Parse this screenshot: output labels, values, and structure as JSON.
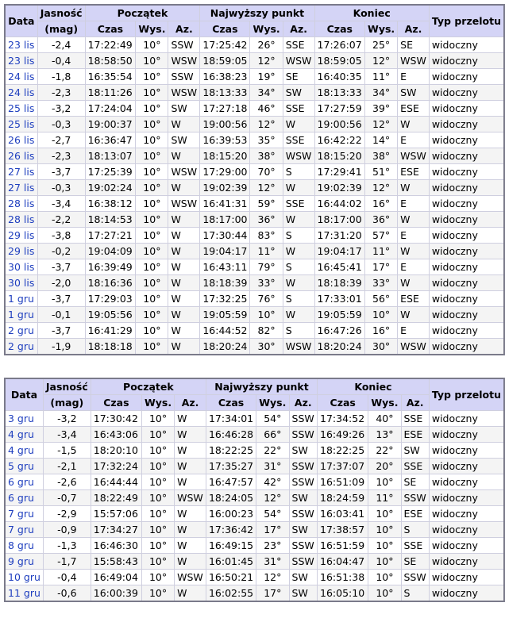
{
  "headers": {
    "data": "Data",
    "jasnosc": "Jasność",
    "mag": "(mag)",
    "poczatek": "Początek",
    "najwyzszy": "Najwyższy punkt",
    "koniec": "Koniec",
    "typ": "Typ przelotu",
    "czas": "Czas",
    "wys": "Wys.",
    "az": "Az."
  },
  "tables": [
    {
      "rows": [
        [
          "23 lis",
          "-2,4",
          "17:22:49",
          "10°",
          "SSW",
          "17:25:42",
          "26°",
          "SSE",
          "17:26:07",
          "25°",
          "SE",
          "widoczny"
        ],
        [
          "23 lis",
          "-0,4",
          "18:58:50",
          "10°",
          "WSW",
          "18:59:05",
          "12°",
          "WSW",
          "18:59:05",
          "12°",
          "WSW",
          "widoczny"
        ],
        [
          "24 lis",
          "-1,8",
          "16:35:54",
          "10°",
          "SSW",
          "16:38:23",
          "19°",
          "SE",
          "16:40:35",
          "11°",
          "E",
          "widoczny"
        ],
        [
          "24 lis",
          "-2,3",
          "18:11:26",
          "10°",
          "WSW",
          "18:13:33",
          "34°",
          "SW",
          "18:13:33",
          "34°",
          "SW",
          "widoczny"
        ],
        [
          "25 lis",
          "-3,2",
          "17:24:04",
          "10°",
          "SW",
          "17:27:18",
          "46°",
          "SSE",
          "17:27:59",
          "39°",
          "ESE",
          "widoczny"
        ],
        [
          "25 lis",
          "-0,3",
          "19:00:37",
          "10°",
          "W",
          "19:00:56",
          "12°",
          "W",
          "19:00:56",
          "12°",
          "W",
          "widoczny"
        ],
        [
          "26 lis",
          "-2,7",
          "16:36:47",
          "10°",
          "SW",
          "16:39:53",
          "35°",
          "SSE",
          "16:42:22",
          "14°",
          "E",
          "widoczny"
        ],
        [
          "26 lis",
          "-2,3",
          "18:13:07",
          "10°",
          "W",
          "18:15:20",
          "38°",
          "WSW",
          "18:15:20",
          "38°",
          "WSW",
          "widoczny"
        ],
        [
          "27 lis",
          "-3,7",
          "17:25:39",
          "10°",
          "WSW",
          "17:29:00",
          "70°",
          "S",
          "17:29:41",
          "51°",
          "ESE",
          "widoczny"
        ],
        [
          "27 lis",
          "-0,3",
          "19:02:24",
          "10°",
          "W",
          "19:02:39",
          "12°",
          "W",
          "19:02:39",
          "12°",
          "W",
          "widoczny"
        ],
        [
          "28 lis",
          "-3,4",
          "16:38:12",
          "10°",
          "WSW",
          "16:41:31",
          "59°",
          "SSE",
          "16:44:02",
          "16°",
          "E",
          "widoczny"
        ],
        [
          "28 lis",
          "-2,2",
          "18:14:53",
          "10°",
          "W",
          "18:17:00",
          "36°",
          "W",
          "18:17:00",
          "36°",
          "W",
          "widoczny"
        ],
        [
          "29 lis",
          "-3,8",
          "17:27:21",
          "10°",
          "W",
          "17:30:44",
          "83°",
          "S",
          "17:31:20",
          "57°",
          "E",
          "widoczny"
        ],
        [
          "29 lis",
          "-0,2",
          "19:04:09",
          "10°",
          "W",
          "19:04:17",
          "11°",
          "W",
          "19:04:17",
          "11°",
          "W",
          "widoczny"
        ],
        [
          "30 lis",
          "-3,7",
          "16:39:49",
          "10°",
          "W",
          "16:43:11",
          "79°",
          "S",
          "16:45:41",
          "17°",
          "E",
          "widoczny"
        ],
        [
          "30 lis",
          "-2,0",
          "18:16:36",
          "10°",
          "W",
          "18:18:39",
          "33°",
          "W",
          "18:18:39",
          "33°",
          "W",
          "widoczny"
        ],
        [
          "1 gru",
          "-3,7",
          "17:29:03",
          "10°",
          "W",
          "17:32:25",
          "76°",
          "S",
          "17:33:01",
          "56°",
          "ESE",
          "widoczny"
        ],
        [
          "1 gru",
          "-0,1",
          "19:05:56",
          "10°",
          "W",
          "19:05:59",
          "10°",
          "W",
          "19:05:59",
          "10°",
          "W",
          "widoczny"
        ],
        [
          "2 gru",
          "-3,7",
          "16:41:29",
          "10°",
          "W",
          "16:44:52",
          "82°",
          "S",
          "16:47:26",
          "16°",
          "E",
          "widoczny"
        ],
        [
          "2 gru",
          "-1,9",
          "18:18:18",
          "10°",
          "W",
          "18:20:24",
          "30°",
          "WSW",
          "18:20:24",
          "30°",
          "WSW",
          "widoczny"
        ]
      ]
    },
    {
      "rows": [
        [
          "3 gru",
          "-3,2",
          "17:30:42",
          "10°",
          "W",
          "17:34:01",
          "54°",
          "SSW",
          "17:34:52",
          "40°",
          "SSE",
          "widoczny"
        ],
        [
          "4 gru",
          "-3,4",
          "16:43:06",
          "10°",
          "W",
          "16:46:28",
          "66°",
          "SSW",
          "16:49:26",
          "13°",
          "ESE",
          "widoczny"
        ],
        [
          "4 gru",
          "-1,5",
          "18:20:10",
          "10°",
          "W",
          "18:22:25",
          "22°",
          "SW",
          "18:22:25",
          "22°",
          "SW",
          "widoczny"
        ],
        [
          "5 gru",
          "-2,1",
          "17:32:24",
          "10°",
          "W",
          "17:35:27",
          "31°",
          "SSW",
          "17:37:07",
          "20°",
          "SSE",
          "widoczny"
        ],
        [
          "6 gru",
          "-2,6",
          "16:44:44",
          "10°",
          "W",
          "16:47:57",
          "42°",
          "SSW",
          "16:51:09",
          "10°",
          "SE",
          "widoczny"
        ],
        [
          "6 gru",
          "-0,7",
          "18:22:49",
          "10°",
          "WSW",
          "18:24:05",
          "12°",
          "SW",
          "18:24:59",
          "11°",
          "SSW",
          "widoczny"
        ],
        [
          "7 gru",
          "-2,9",
          "15:57:06",
          "10°",
          "W",
          "16:00:23",
          "54°",
          "SSW",
          "16:03:41",
          "10°",
          "ESE",
          "widoczny"
        ],
        [
          "7 gru",
          "-0,9",
          "17:34:27",
          "10°",
          "W",
          "17:36:42",
          "17°",
          "SW",
          "17:38:57",
          "10°",
          "S",
          "widoczny"
        ],
        [
          "8 gru",
          "-1,3",
          "16:46:30",
          "10°",
          "W",
          "16:49:15",
          "23°",
          "SSW",
          "16:51:59",
          "10°",
          "SSE",
          "widoczny"
        ],
        [
          "9 gru",
          "-1,7",
          "15:58:43",
          "10°",
          "W",
          "16:01:45",
          "31°",
          "SSW",
          "16:04:47",
          "10°",
          "SE",
          "widoczny"
        ],
        [
          "10 gru",
          "-0,4",
          "16:49:04",
          "10°",
          "WSW",
          "16:50:21",
          "12°",
          "SW",
          "16:51:38",
          "10°",
          "SSW",
          "widoczny"
        ],
        [
          "11 gru",
          "-0,6",
          "16:00:39",
          "10°",
          "W",
          "16:02:55",
          "17°",
          "SW",
          "16:05:10",
          "10°",
          "S",
          "widoczny"
        ]
      ]
    }
  ]
}
